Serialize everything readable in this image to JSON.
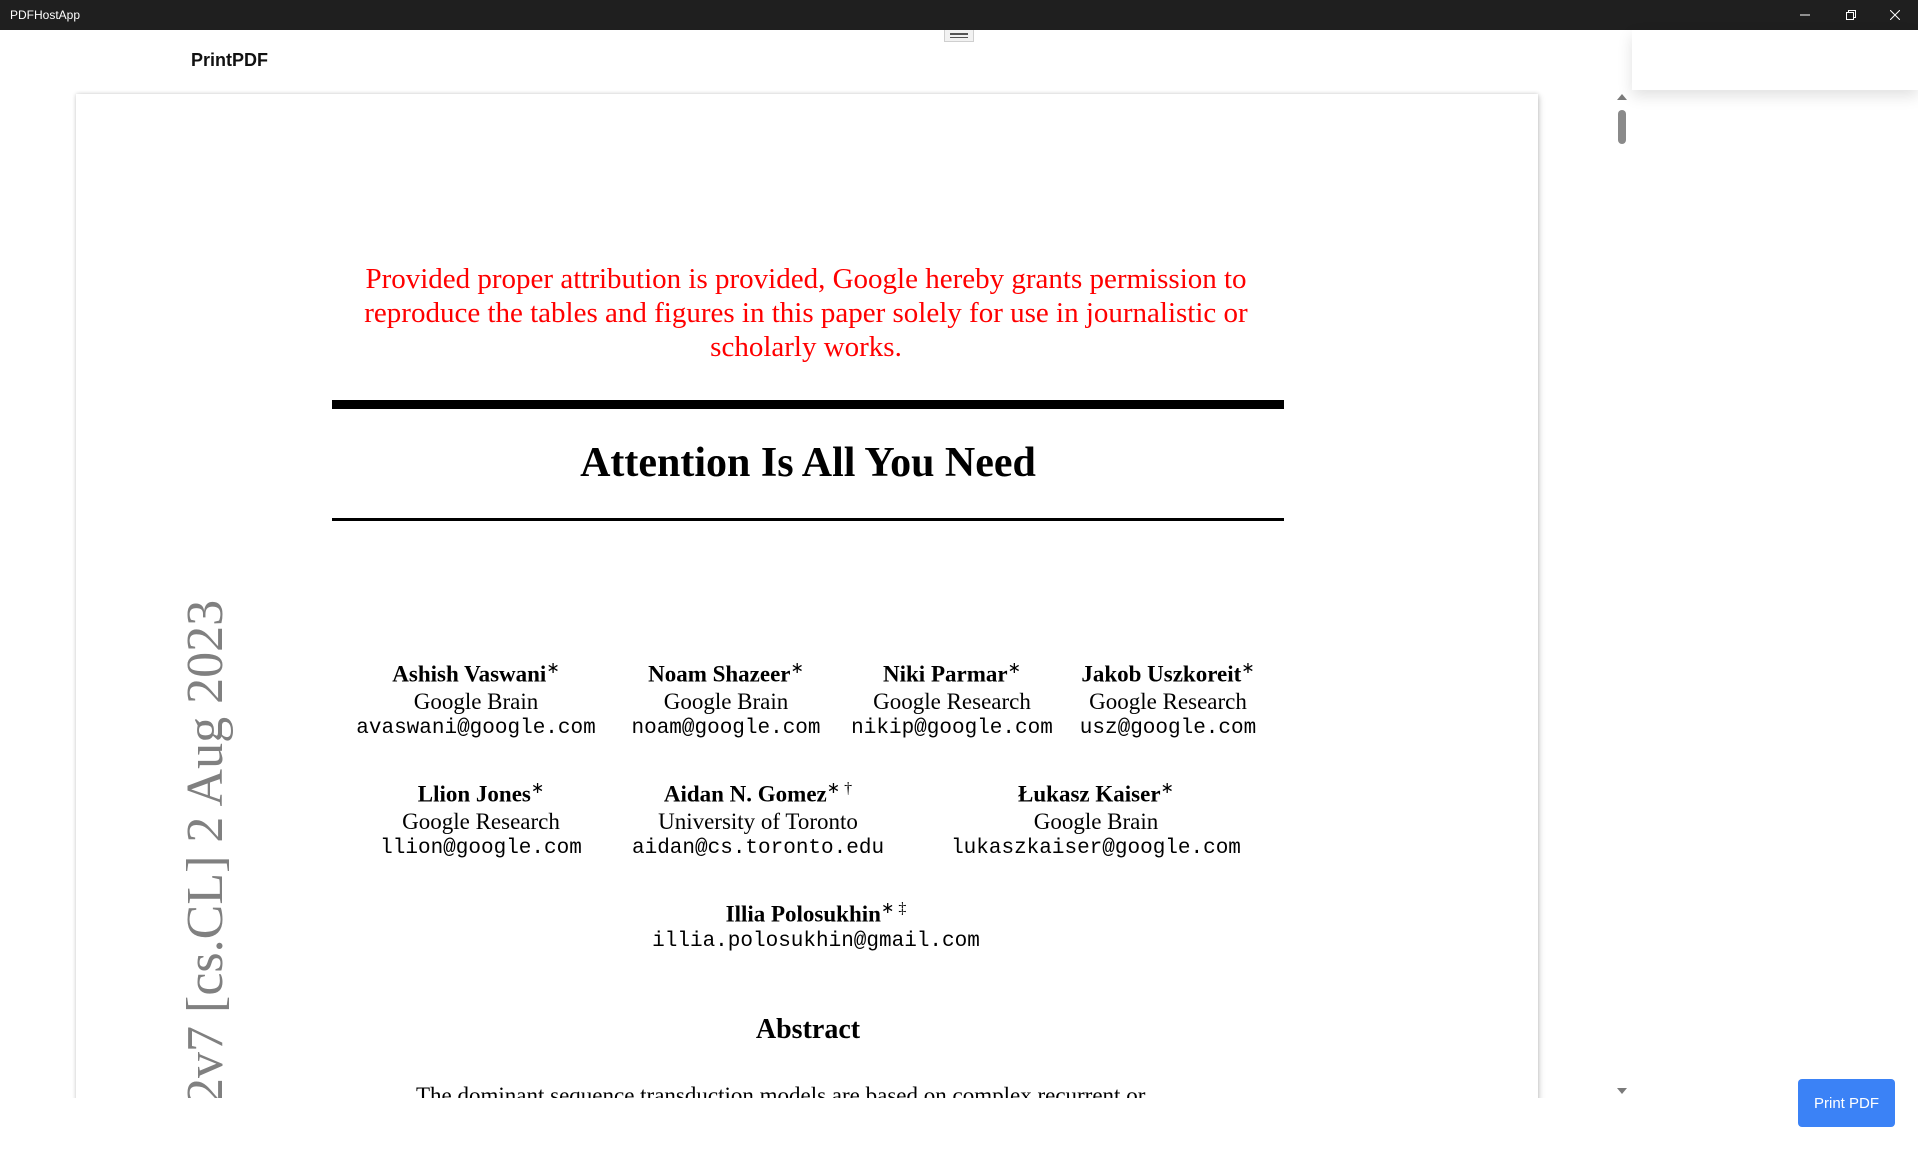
{
  "window": {
    "title": "PDFHostApp"
  },
  "header": {
    "title": "PrintPDF"
  },
  "document": {
    "notice_line1": "Provided proper attribution is provided, Google hereby grants permission to",
    "notice_line2": "reproduce the tables and figures in this paper solely for use in journalistic or",
    "notice_line3": "scholarly works.",
    "paper_title": "Attention Is All You Need",
    "authors": [
      {
        "name": "Ashish Vaswani",
        "mark": "∗",
        "affiliation": "Google Brain",
        "email": "avaswani@google.com"
      },
      {
        "name": "Noam Shazeer",
        "mark": "∗",
        "affiliation": "Google Brain",
        "email": "noam@google.com"
      },
      {
        "name": "Niki Parmar",
        "mark": "∗",
        "affiliation": "Google Research",
        "email": "nikip@google.com"
      },
      {
        "name": "Jakob Uszkoreit",
        "mark": "∗",
        "affiliation": "Google Research",
        "email": "usz@google.com"
      },
      {
        "name": "Llion Jones",
        "mark": "∗",
        "affiliation": "Google Research",
        "email": "llion@google.com"
      },
      {
        "name": "Aidan N. Gomez",
        "mark": "∗ †",
        "affiliation": "University of Toronto",
        "email": "aidan@cs.toronto.edu"
      },
      {
        "name": "Łukasz Kaiser",
        "mark": "∗",
        "affiliation": "Google Brain",
        "email": "lukaszkaiser@google.com"
      },
      {
        "name": "Illia Polosukhin",
        "mark": "∗ ‡",
        "affiliation": "",
        "email": "illia.polosukhin@gmail.com"
      }
    ],
    "abstract_heading": "Abstract",
    "abstract_first_line": "The dominant sequence transduction models are based on complex recurrent or",
    "arxiv_stamp": "2v7 [cs.CL] 2 Aug 2023"
  },
  "actions": {
    "print_label": "Print PDF"
  },
  "colors": {
    "titlebar": "#1f1f1f",
    "notice_text": "#ff0000",
    "print_button": "#3b82f6",
    "stamp_text": "#808080"
  }
}
